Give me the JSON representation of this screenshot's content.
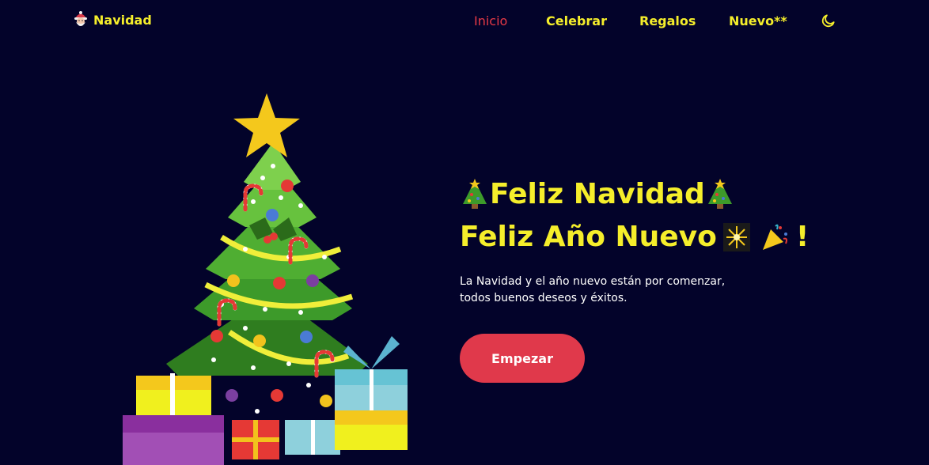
{
  "brand": {
    "name": "Navidad",
    "icon": "santa-icon"
  },
  "nav": {
    "items": [
      {
        "label": "Inicio",
        "active": true
      },
      {
        "label": "Celebrar",
        "active": false
      },
      {
        "label": "Regalos",
        "active": false
      },
      {
        "label": "Nuevo**",
        "active": false
      }
    ],
    "theme_toggle_icon": "moon-icon"
  },
  "hero": {
    "title_line1": "Feliz Navidad",
    "title_line2": "Feliz Año Nuevo",
    "title_line2_suffix": "!",
    "title_line1_emojis": [
      "christmas-tree-icon",
      "christmas-tree-icon"
    ],
    "title_line2_emojis": [
      "sparkler-icon",
      "party-popper-icon"
    ],
    "subtitle": "La Navidad y el año nuevo están por comenzar, todos buenos deseos y éxitos.",
    "cta_label": "Empezar"
  },
  "colors": {
    "background": "#03032a",
    "accent_yellow": "#f5ee2b",
    "accent_red": "#e0394b",
    "active_link": "#e63946"
  }
}
